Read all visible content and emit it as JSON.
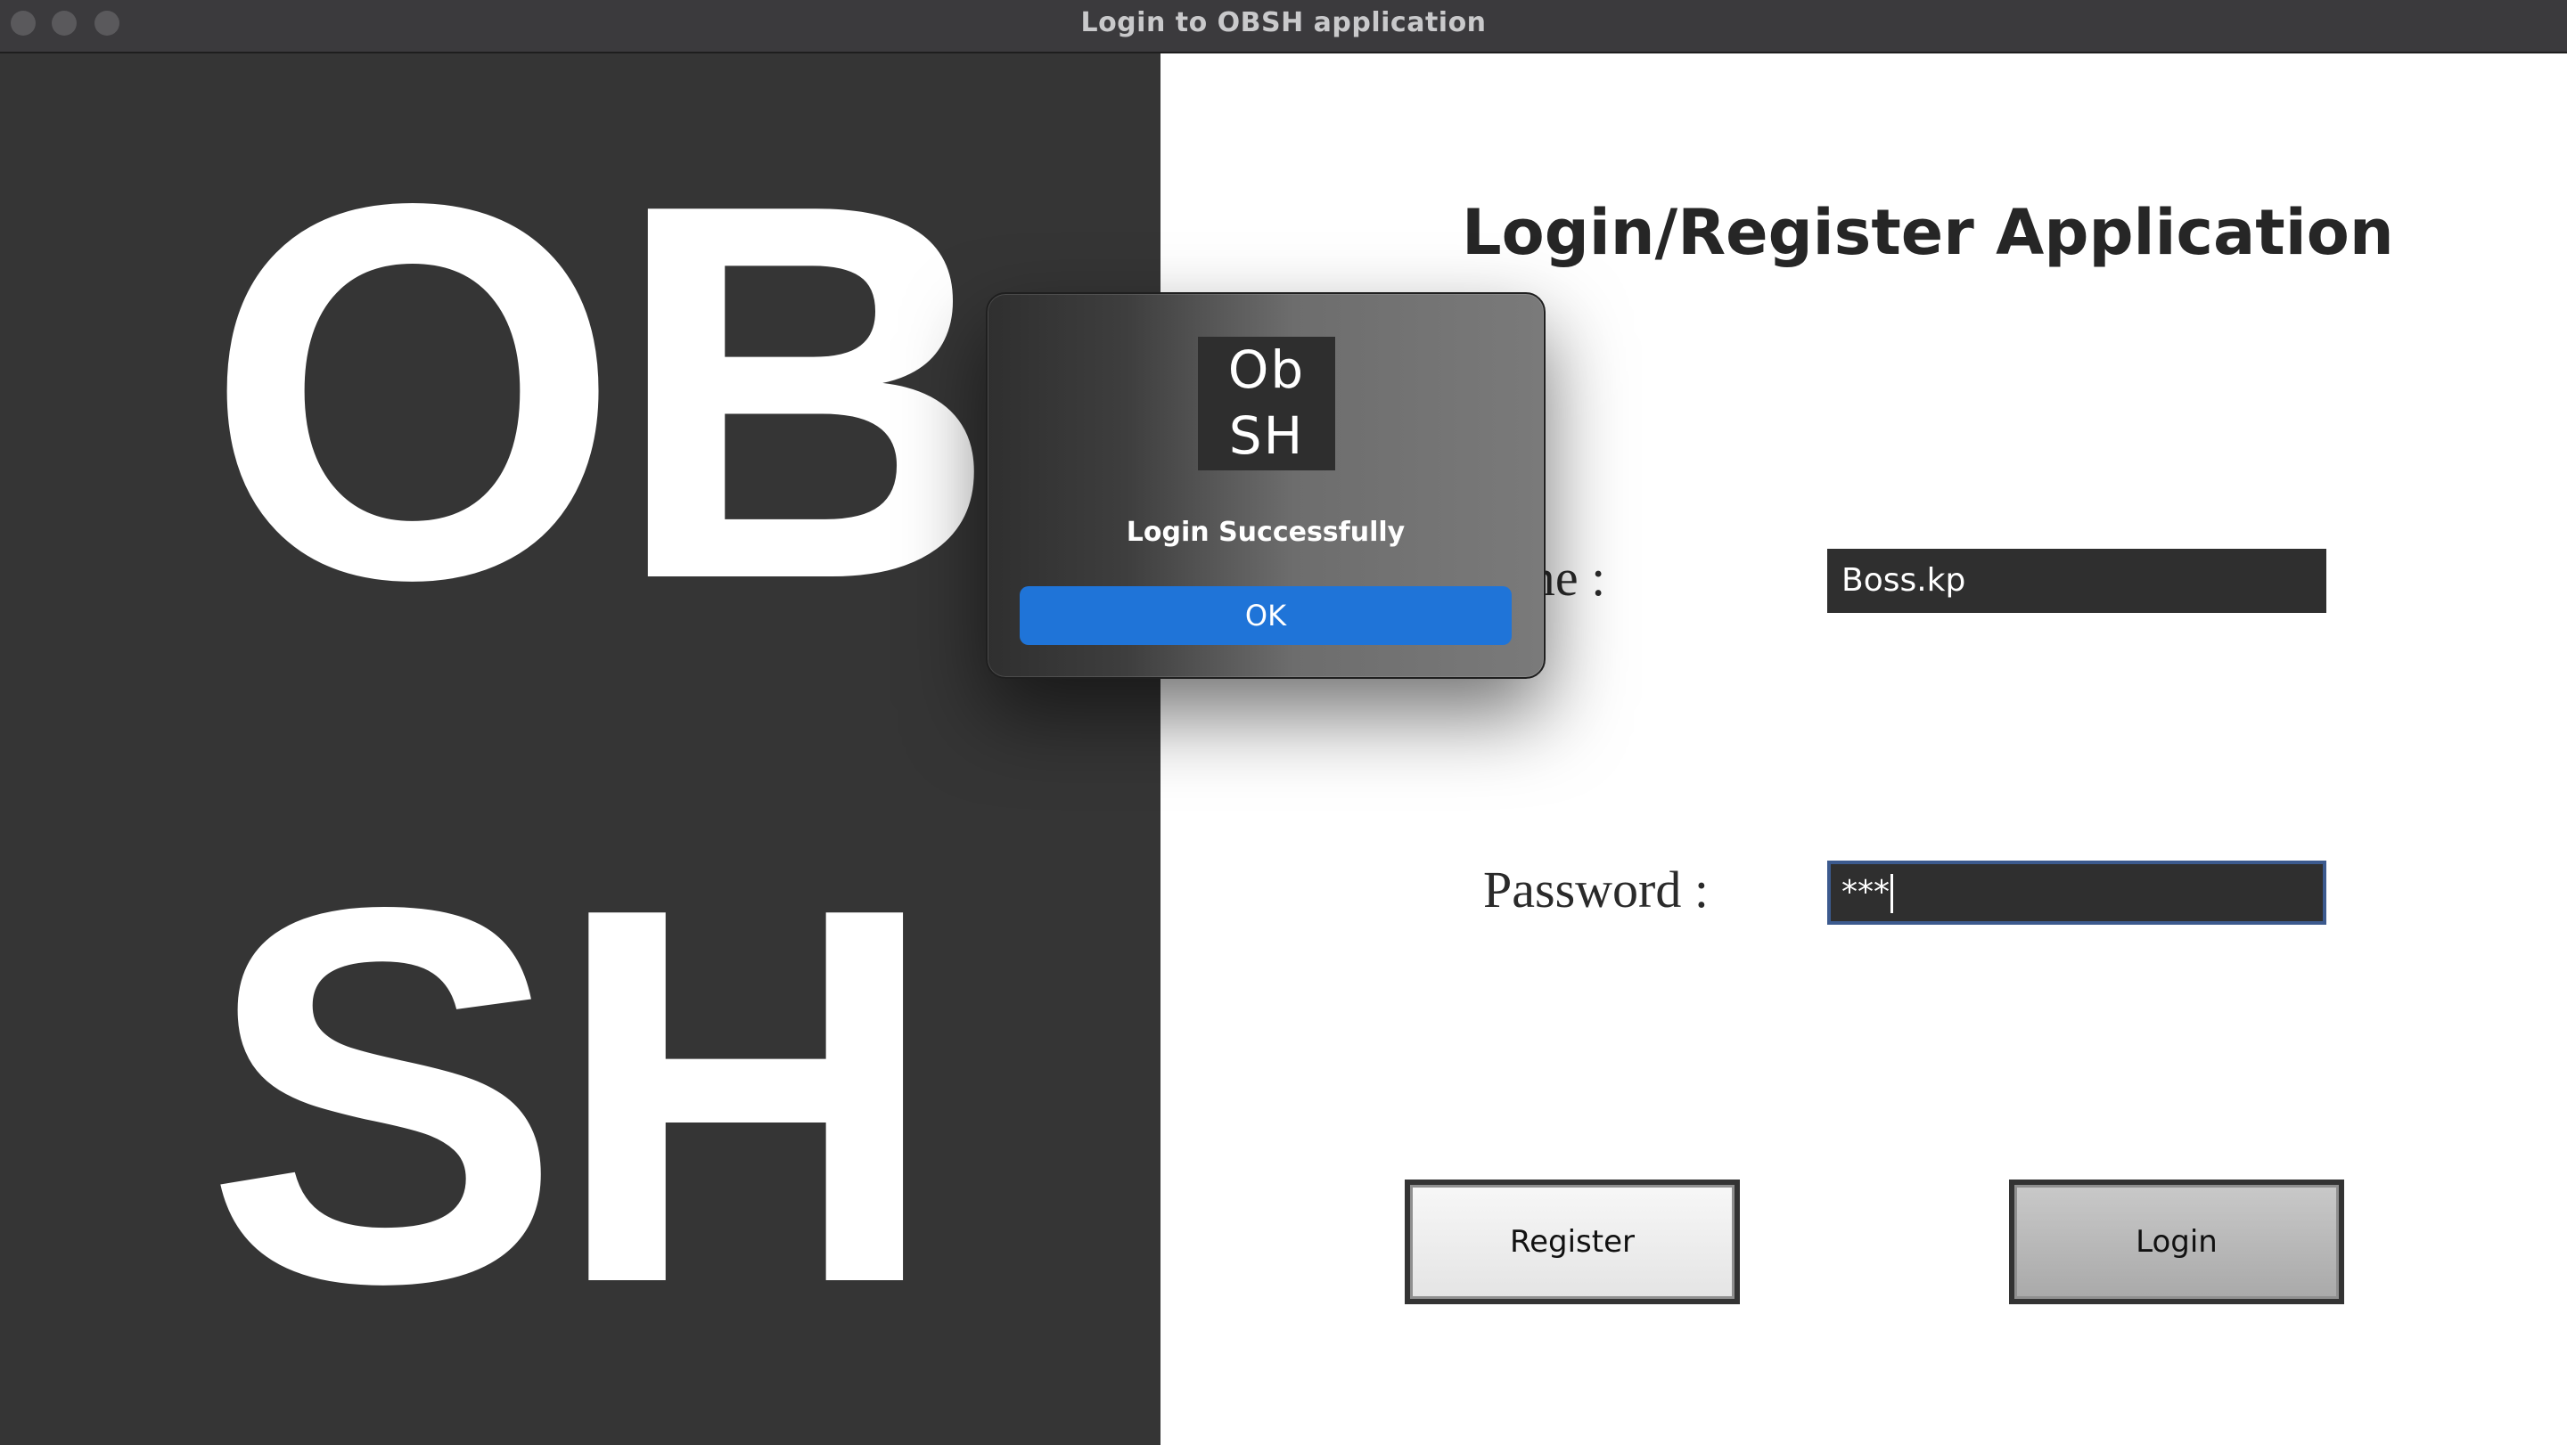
{
  "window": {
    "title": "Login to OBSH application",
    "traffic_lights": [
      "close",
      "minimize",
      "zoom"
    ]
  },
  "logo": {
    "line1": "OB",
    "line2": "SH"
  },
  "form": {
    "heading": "Login/Register Application",
    "username_label": "ername :",
    "username_value": "Boss.kp",
    "password_label": "Password  :",
    "password_value": "***",
    "register_label": "Register",
    "login_label": "Login"
  },
  "dialog": {
    "icon_line1": "Ob",
    "icon_line2": "SH",
    "message": "Login Successfully",
    "ok_label": "OK"
  },
  "colors": {
    "left_panel": "#353535",
    "input_bg": "#2f2f2f",
    "ok_button": "#1f74d8",
    "focus_border": "#3c5a8e"
  }
}
